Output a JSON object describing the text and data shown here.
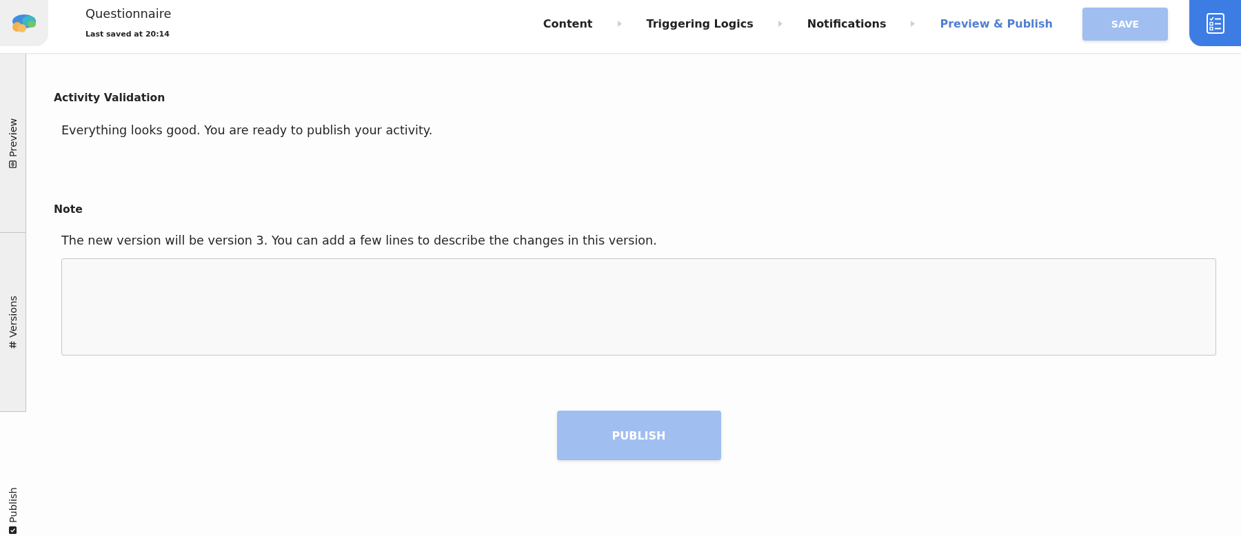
{
  "app": {
    "title": "Questionnaire",
    "last_saved": "Last saved at 20:14"
  },
  "steps": [
    {
      "label": "Content",
      "selected": false
    },
    {
      "label": "Triggering Logics",
      "selected": false
    },
    {
      "label": "Notifications",
      "selected": false
    },
    {
      "label": "Preview & Publish",
      "selected": true
    }
  ],
  "save_button": {
    "label": "SAVE",
    "disabled": true
  },
  "side_tabs": [
    {
      "kind": "preview",
      "label": "Preview",
      "selected": false
    },
    {
      "kind": "versions",
      "label": "Versions",
      "selected": false
    },
    {
      "kind": "publish",
      "label": "Publish",
      "selected": true
    }
  ],
  "validation": {
    "heading": "Activity Validation",
    "message": "Everything looks good. You are ready to publish your activity."
  },
  "note": {
    "heading": "Note",
    "description": "The new version will be version 3. You can add a few lines to describe the changes in this version."
  },
  "publish_button": {
    "label": "PUBLISH",
    "disabled": true
  }
}
